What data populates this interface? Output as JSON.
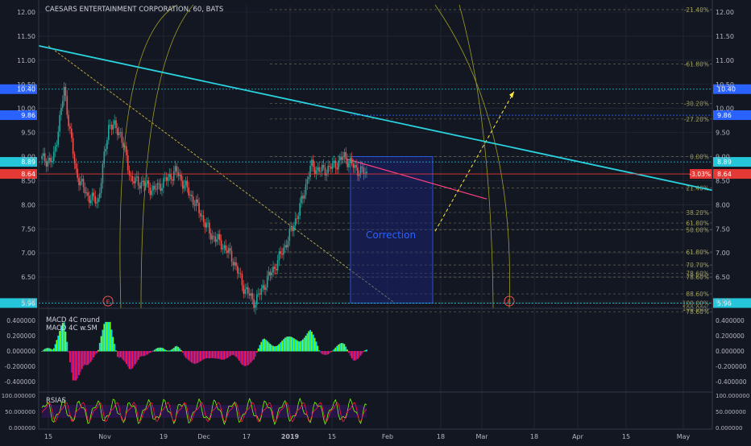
{
  "header": {
    "title": "CAESARS ENTERTAINMENT CORPORATION, 60, BATS"
  },
  "colors": {
    "background": "#131722",
    "grid": "#2a2e39",
    "axis_text": "#b2b5be",
    "trendline": "#29d3e0",
    "horizontal_line": "#26c6da",
    "price_line": "#e53935",
    "fib_line": "#cfcf6a",
    "bull_candle": "#26a69a",
    "bear_candle": "#ef5350",
    "correction_box": "#1a237e",
    "projection": "#ffeb3b",
    "event_marker": "#ef5350"
  },
  "price_axis": {
    "ticks": [
      "12.00",
      "11.50",
      "11.00",
      "10.50",
      "10.00",
      "9.50",
      "9.00",
      "8.50",
      "8.00",
      "7.50",
      "7.00",
      "6.50",
      "6.00"
    ],
    "range": [
      5.85,
      12.05
    ]
  },
  "time_axis": {
    "ticks": [
      "15",
      "Nov",
      "19",
      "Dec",
      "17",
      "2019",
      "15",
      "Feb",
      "18",
      "Mar",
      "18",
      "Apr",
      "15",
      "May"
    ]
  },
  "price_labels": [
    {
      "value": "10.40",
      "color": "#2962ff",
      "side": "both"
    },
    {
      "value": "9.86",
      "color": "#2962ff",
      "side": "both"
    },
    {
      "value": "8.89",
      "color": "#26c6da",
      "side": "both"
    },
    {
      "value": "8.64",
      "color": "#e53935",
      "side": "both"
    },
    {
      "value": "5.96",
      "color": "#26c6da",
      "side": "both"
    }
  ],
  "change_label": "-3.03%",
  "correction_label": "Correction",
  "event_marker_letter": "E",
  "fib_levels": [
    {
      "label": "-21.40%",
      "price": 12.05
    },
    {
      "label": "-61.80%",
      "price": 10.92
    },
    {
      "label": "-30.20%",
      "price": 10.1
    },
    {
      "label": "-27.20%",
      "price": 9.78
    },
    {
      "label": "0.00%",
      "price": 9.0
    },
    {
      "label": "21.40%",
      "price": 8.35
    },
    {
      "label": "38.20%",
      "price": 7.84
    },
    {
      "label": "61.80%",
      "price": 7.62
    },
    {
      "label": "50.00%",
      "price": 7.48
    },
    {
      "label": "61.80%",
      "price": 7.02
    },
    {
      "label": "70.70%",
      "price": 6.75
    },
    {
      "label": "78.60%",
      "price": 6.58
    },
    {
      "label": "78.60%",
      "price": 6.5
    },
    {
      "label": "88.60%",
      "price": 6.15
    },
    {
      "label": "100.00%",
      "price": 5.96
    },
    {
      "label": "100.00%",
      "price": 5.85
    },
    {
      "label": "78.60%",
      "price": 5.78
    }
  ],
  "macd": {
    "label1": "MACD 4C round",
    "label2": "MACD 4C w.SM",
    "ticks": [
      "0.400000",
      "0.200000",
      "0.000000",
      "-0.200000",
      "-0.400000"
    ],
    "right_ticks": [
      "0.400000",
      "0.200000",
      "0.000000",
      "-0.200000",
      "-0.400000"
    ]
  },
  "rsi": {
    "label": "RSIAS",
    "ticks": [
      "100.000000",
      "50.000000",
      "0.000000"
    ]
  },
  "chart_data": {
    "type": "line",
    "title": "CAESARS ENTERTAINMENT CORPORATION, 60, BATS",
    "xlabel": "",
    "ylabel": "",
    "ylim": [
      5.85,
      12.05
    ],
    "series": [
      {
        "x": [
          "Oct 15",
          "Oct 17",
          "Oct 19",
          "Oct 24",
          "Oct 26",
          "Oct 29",
          "Nov 2",
          "Nov 6",
          "Nov 9",
          "Nov 13",
          "Nov 19",
          "Nov 23",
          "Nov 28",
          "Dec 3",
          "Dec 6",
          "Dec 10",
          "Dec 14",
          "Dec 18",
          "Dec 21",
          "Dec 24",
          "Dec 26",
          "Dec 28",
          "Jan 2",
          "Jan 4",
          "Jan 8",
          "Jan 11",
          "Jan 15",
          "Jan 17",
          "Jan 22",
          "Jan 24"
        ],
        "values": [
          8.95,
          8.9,
          10.4,
          8.7,
          8.2,
          8.05,
          9.7,
          9.5,
          8.5,
          8.45,
          8.3,
          8.5,
          8.7,
          8.3,
          7.9,
          7.4,
          7.2,
          6.9,
          6.3,
          5.96,
          6.4,
          6.8,
          7.3,
          7.9,
          8.8,
          8.7,
          8.8,
          9.0,
          8.75,
          8.64
        ]
      }
    ],
    "trendlines": [
      {
        "from": {
          "x": "Oct 15",
          "y": 11.3
        },
        "to": {
          "x": "May 15",
          "y": 8.3
        }
      }
    ],
    "horizontal_lines": [
      10.4,
      9.86,
      8.89,
      8.64,
      5.96
    ]
  }
}
